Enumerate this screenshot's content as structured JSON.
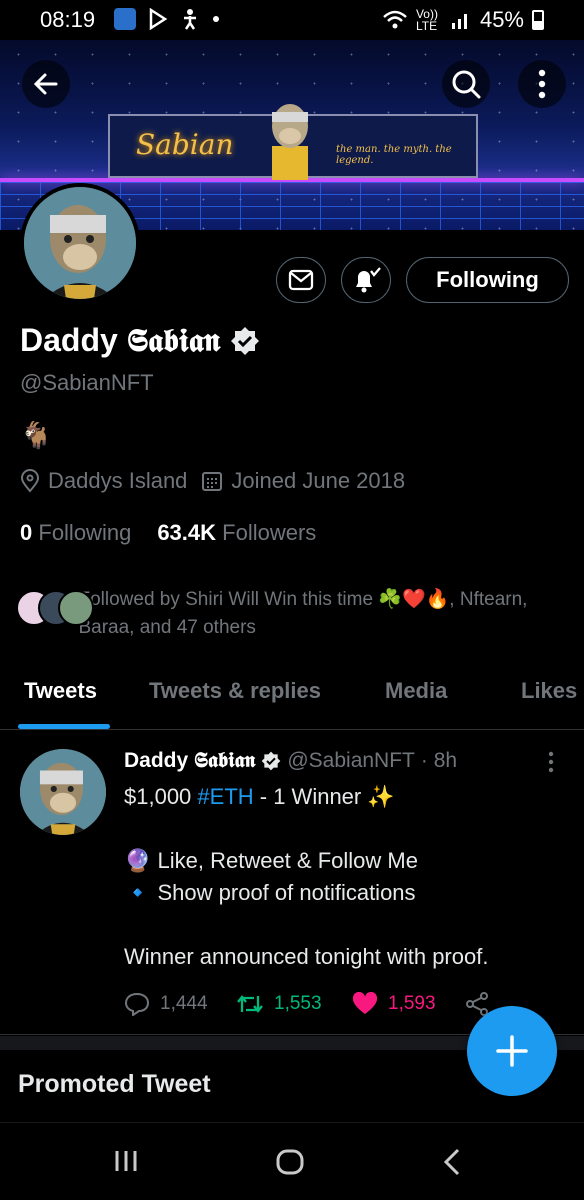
{
  "status_bar": {
    "time": "08:19",
    "network": "Vo)) LTE",
    "battery": "45%"
  },
  "banner": {
    "title": "Sabian",
    "tagline": "the man. the myth. the legend."
  },
  "profile": {
    "display_name": "Daddy 𝕾𝖆𝖇𝖎𝖆𝖓",
    "handle": "@SabianNFT",
    "bio": "🐐",
    "location": "Daddys Island",
    "joined": "Joined June 2018",
    "following_count": "0",
    "following_label": "Following",
    "followers_count": "63.4K",
    "followers_label": "Followers",
    "followed_by": "Followed by Shiri Will Win this time ☘️❤️🔥, Nftearn, Baraa, and 47 others",
    "follow_button": "Following"
  },
  "tabs": [
    {
      "label": "Tweets",
      "active": true
    },
    {
      "label": "Tweets & replies",
      "active": false
    },
    {
      "label": "Media",
      "active": false
    },
    {
      "label": "Likes",
      "active": false
    }
  ],
  "tweet": {
    "author": "Daddy 𝕾𝖆𝖇𝖎𝖆𝖓",
    "handle": "@SabianNFT",
    "time": "· 8h",
    "line1_pre": "$1,000 ",
    "line1_link": "#ETH",
    "line1_post": " - 1 Winner ✨",
    "line2": "🔮 Like, Retweet & Follow Me",
    "line3": "🔹 Show proof of notifications",
    "line4": "Winner announced tonight with proof.",
    "replies": "1,444",
    "retweets": "1,553",
    "likes": "1,593"
  },
  "promoted_label": "Promoted Tweet",
  "colors": {
    "accent": "#1d9bf0",
    "retweet": "#00ba7c",
    "like": "#f91880",
    "muted": "#71767b"
  }
}
